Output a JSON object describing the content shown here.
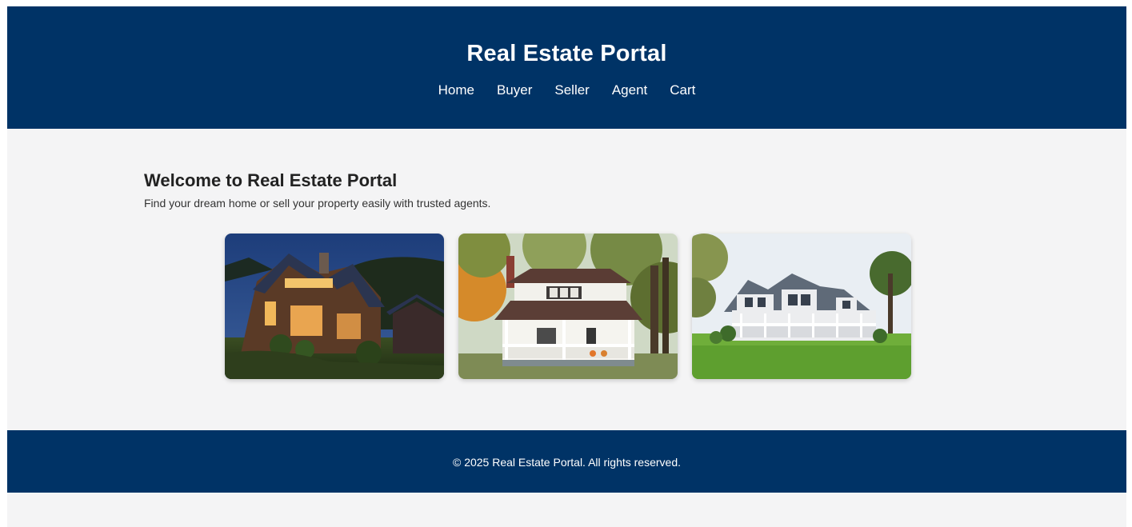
{
  "header": {
    "title": "Real Estate Portal",
    "nav": [
      "Home",
      "Buyer",
      "Seller",
      "Agent",
      "Cart"
    ]
  },
  "main": {
    "heading": "Welcome to Real Estate Portal",
    "subheading": "Find your dream home or sell your property easily with trusted agents."
  },
  "gallery": [
    {
      "alt": "modern wooden house at dusk"
    },
    {
      "alt": "white porch house in autumn"
    },
    {
      "alt": "grey colonial house with lawn"
    }
  ],
  "footer": {
    "copyright": "© 2025 Real Estate Portal. All rights reserved."
  },
  "colors": {
    "brand": "#003366",
    "background": "#f4f4f5"
  }
}
